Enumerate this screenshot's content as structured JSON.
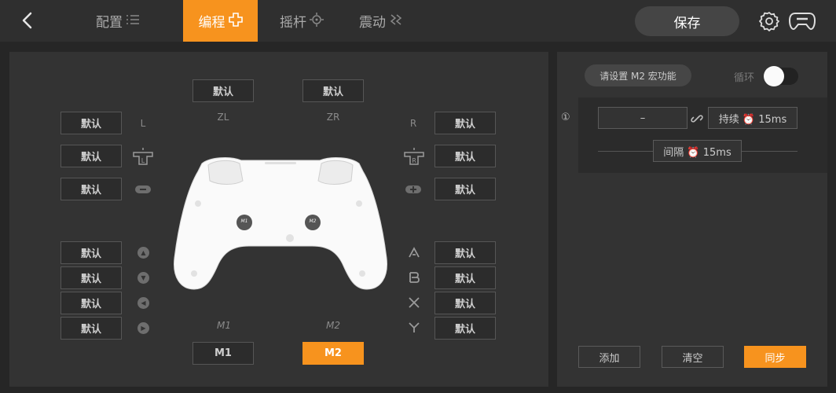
{
  "topbar": {
    "tabs": [
      {
        "label": "配置",
        "icon": "list-icon"
      },
      {
        "label": "编程",
        "icon": "dpad-plus-icon"
      },
      {
        "label": "摇杆",
        "icon": "crosshair-icon"
      },
      {
        "label": "震动",
        "icon": "vibration-icon"
      }
    ],
    "save_label": "保存",
    "accent": "#f7931e"
  },
  "mapping": {
    "zl": {
      "button": "默认",
      "label": "ZL"
    },
    "zr": {
      "button": "默认",
      "label": "ZR"
    },
    "l": {
      "button": "默认",
      "label": "L"
    },
    "l_stick": {
      "button": "默认"
    },
    "minus": {
      "button": "默认"
    },
    "r": {
      "button": "默认",
      "label": "R"
    },
    "r_stick": {
      "button": "默认"
    },
    "plus": {
      "button": "默认"
    },
    "dpad": [
      {
        "button": "默认"
      },
      {
        "button": "默认"
      },
      {
        "button": "默认"
      },
      {
        "button": "默认"
      }
    ],
    "face": [
      {
        "button": "默认"
      },
      {
        "button": "默认"
      },
      {
        "button": "默认"
      },
      {
        "button": "默认"
      }
    ],
    "m1": {
      "button": "M1",
      "label": "M1"
    },
    "m2": {
      "button": "M2",
      "label": "M2"
    },
    "controller": {
      "m1_tag": "M1",
      "m2_tag": "M2"
    }
  },
  "macro": {
    "title": "请设置 M2 宏功能",
    "loop_label": "循环",
    "loop_on": false,
    "step_number": "①",
    "step_key": "–",
    "duration": "持续 ⏰ 15ms",
    "interval": "间隔 ⏰ 15ms",
    "add_label": "添加",
    "clear_label": "清空",
    "sync_label": "同步"
  }
}
